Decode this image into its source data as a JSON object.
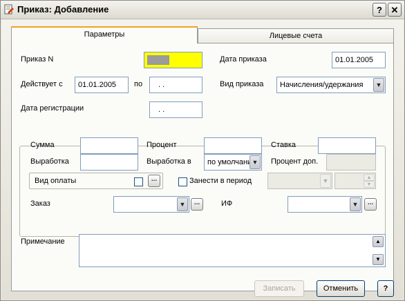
{
  "window": {
    "title": "Приказ: Добавление",
    "help_glyph": "?",
    "close_glyph": "✕"
  },
  "tabs": [
    {
      "label": "Параметры",
      "active": true
    },
    {
      "label": "Лицевые счета",
      "active": false
    }
  ],
  "fields": {
    "order_no": {
      "label": "Приказ N",
      "value": ""
    },
    "order_date": {
      "label": "Дата приказа",
      "value": "01.01.2005"
    },
    "valid_from": {
      "label": "Действует с",
      "value": "01.01.2005"
    },
    "valid_to": {
      "label": "по",
      "value": ". ."
    },
    "order_type": {
      "label": "Вид приказа",
      "value": "Начисления/удержания"
    },
    "reg_date": {
      "label": "Дата регистрации",
      "value": ". ."
    }
  },
  "group": {
    "sum": {
      "label": "Сумма",
      "value": ""
    },
    "percent": {
      "label": "Процент",
      "value": ""
    },
    "rate": {
      "label": "Ставка",
      "value": ""
    },
    "output": {
      "label": "Выработка",
      "value": ""
    },
    "output_in": {
      "label": "Выработка в",
      "value": "по умолчани"
    },
    "percent_extra": {
      "label": "Процент доп.",
      "value": ""
    },
    "pay_type": {
      "label": "Вид оплаты",
      "checked": false
    },
    "add_to_period": {
      "label": "Занести в период",
      "checked": false
    },
    "order": {
      "label": "Заказ",
      "value": ""
    },
    "if": {
      "label": "ИФ",
      "value": ""
    }
  },
  "note": {
    "label": "Примечание",
    "value": ""
  },
  "buttons": {
    "save": "Записать",
    "cancel": "Отменить",
    "help": "?",
    "dots": "..."
  },
  "icons": {
    "window_icon": "document-edit-icon",
    "dropdown": "▼",
    "spin_up": "▲",
    "spin_down": "▼",
    "scroll_up": "▲",
    "scroll_down": "▼"
  },
  "colors": {
    "active_tab_accent": "#f5a020",
    "order_no_highlight": "#ffff00"
  }
}
